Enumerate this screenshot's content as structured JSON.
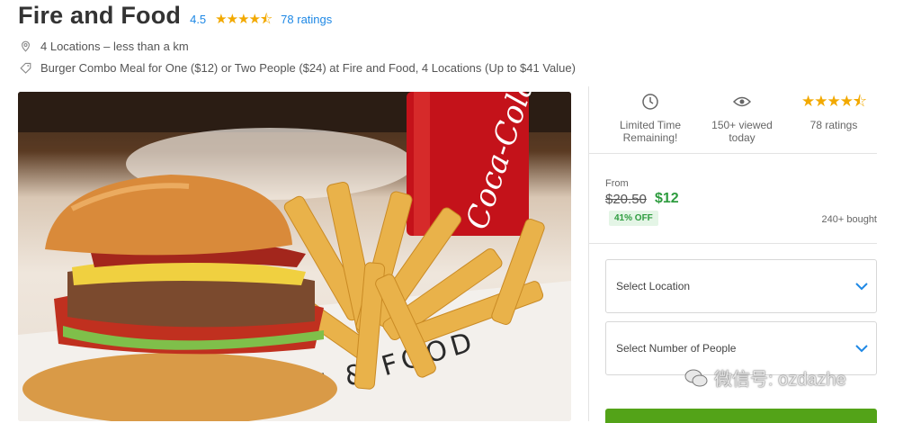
{
  "header": {
    "title": "Fire and Food",
    "rating_value": "4.5",
    "rating_stars": "★★★★⯪",
    "rating_count": "78 ratings"
  },
  "info": {
    "locations": "4 Locations – less than a km",
    "deal": "Burger Combo Meal for One ($12) or Two People ($24) at Fire and Food, 4 Locations (Up to $41 Value)"
  },
  "photo": {
    "can_text": "Coca-Cola",
    "board_text": "FIRE & FOOD"
  },
  "stats": {
    "time": {
      "line1": "Limited Time",
      "line2": "Remaining!",
      "icon": "clock-icon"
    },
    "views": {
      "line1": "150+ viewed",
      "line2": "today",
      "icon": "eye-icon"
    },
    "ratings": {
      "stars": "★★★★⯪",
      "label": "78 ratings"
    }
  },
  "pricing": {
    "from_label": "From",
    "original_price": "$20.50",
    "sale_price": "$12",
    "discount_badge": "41% OFF",
    "bought_count": "240+ bought"
  },
  "options": {
    "location_label": "Select Location",
    "people_label": "Select Number of People"
  },
  "colors": {
    "accent_blue": "#1e88e5",
    "star_gold": "#f2a900",
    "price_green": "#2e9c3f",
    "cta_green": "#53a318"
  },
  "watermark": {
    "text": "微信号: ozdazhe"
  }
}
